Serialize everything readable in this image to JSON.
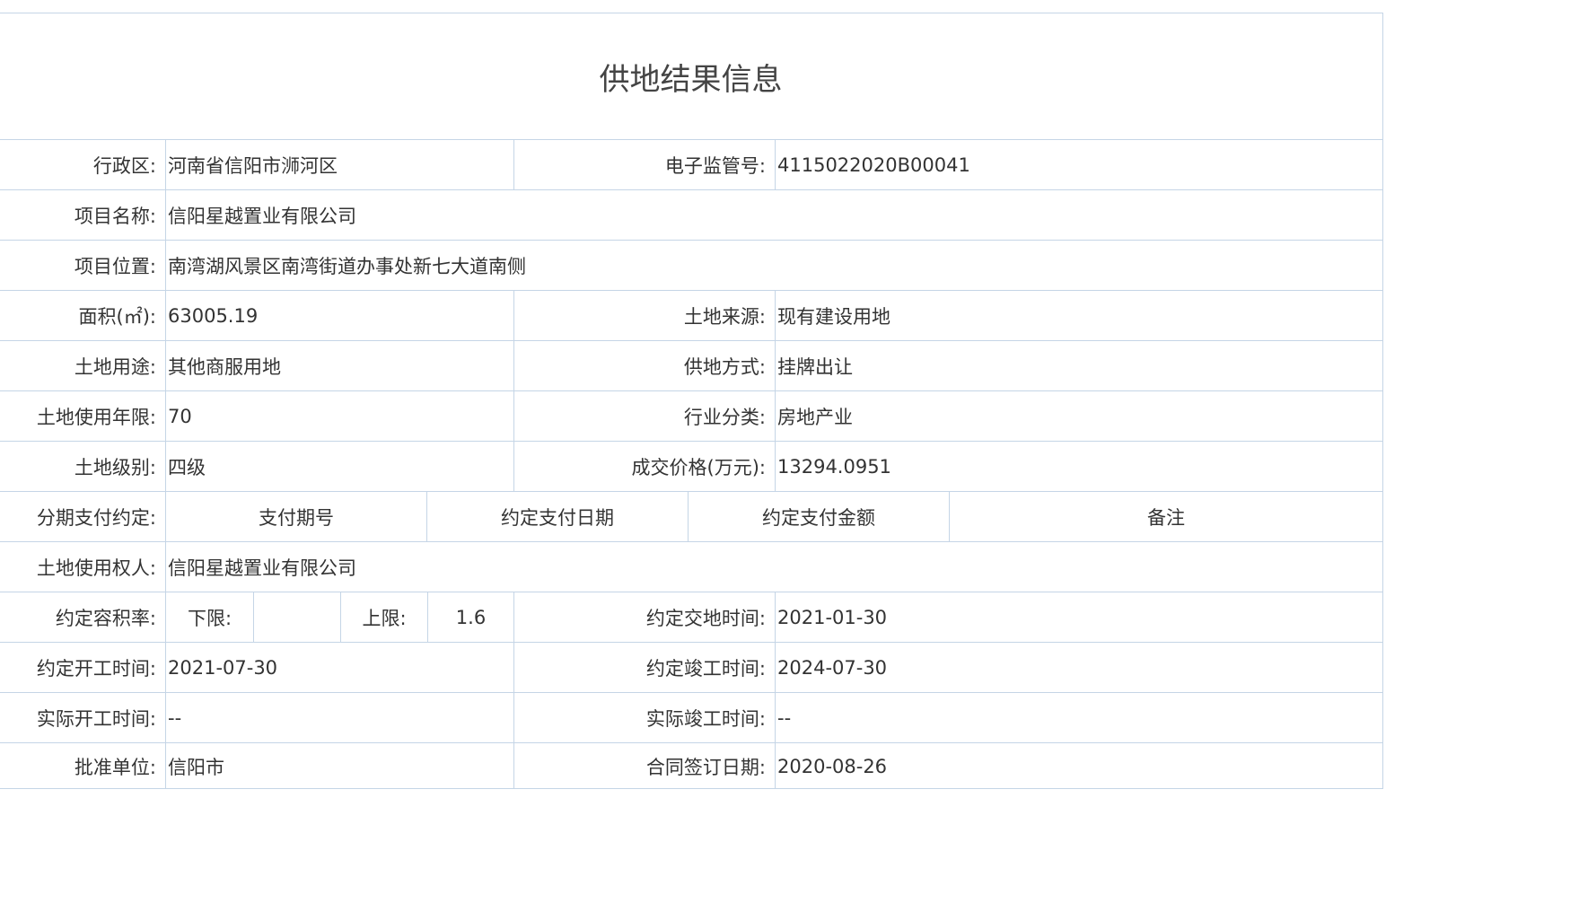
{
  "title": "供地结果信息",
  "rows": {
    "district": {
      "label": "行政区:",
      "value": "河南省信阳市浉河区"
    },
    "supervision_no": {
      "label": "电子监管号:",
      "value": "4115022020B00041"
    },
    "project_name": {
      "label": "项目名称:",
      "value": "信阳星越置业有限公司"
    },
    "project_location": {
      "label": "项目位置:",
      "value": "南湾湖风景区南湾街道办事处新七大道南侧"
    },
    "area": {
      "label": "面积(㎡):",
      "value": "63005.19"
    },
    "land_source": {
      "label": "土地来源:",
      "value": "现有建设用地"
    },
    "land_use": {
      "label": "土地用途:",
      "value": "其他商服用地"
    },
    "supply_method": {
      "label": "供地方式:",
      "value": "挂牌出让"
    },
    "term": {
      "label": "土地使用年限:",
      "value": "70"
    },
    "industry": {
      "label": "行业分类:",
      "value": "房地产业"
    },
    "land_grade": {
      "label": "土地级别:",
      "value": "四级"
    },
    "price": {
      "label": "成交价格(万元):",
      "value": "13294.0951"
    },
    "installments": {
      "label": "分期支付约定:",
      "headers": [
        "支付期号",
        "约定支付日期",
        "约定支付金额",
        "备注"
      ]
    },
    "land_user": {
      "label": "土地使用权人:",
      "value": "信阳星越置业有限公司"
    },
    "far": {
      "label": "约定容积率:",
      "lower_label": "下限:",
      "lower_value": "",
      "upper_label": "上限:",
      "upper_value": "1.6"
    },
    "delivery_date": {
      "label": "约定交地时间:",
      "value": "2021-01-30"
    },
    "start_date": {
      "label": "约定开工时间:",
      "value": "2021-07-30"
    },
    "completion_date": {
      "label": "约定竣工时间:",
      "value": "2024-07-30"
    },
    "actual_start": {
      "label": "实际开工时间:",
      "value": "--"
    },
    "actual_completion": {
      "label": "实际竣工时间:",
      "value": "--"
    },
    "approver": {
      "label": "批准单位:",
      "value": "信阳市"
    },
    "contract_date": {
      "label": "合同签订日期:",
      "value": "2020-08-26"
    }
  }
}
